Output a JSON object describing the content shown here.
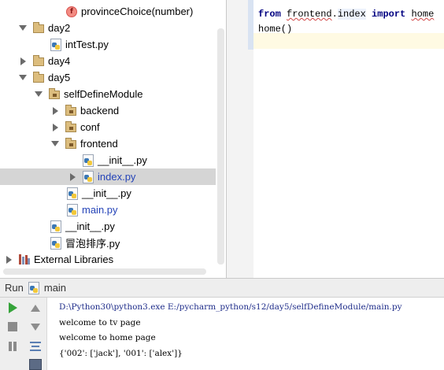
{
  "project_tree": {
    "items": [
      {
        "label": "provinceChoice(number)",
        "icon": "function-icon",
        "expand": "none",
        "color": "black"
      },
      {
        "label": "day2",
        "icon": "folder-icon",
        "expand": "down",
        "color": "black"
      },
      {
        "label": "intTest.py",
        "icon": "python-file-icon",
        "expand": "none",
        "color": "black"
      },
      {
        "label": "day4",
        "icon": "folder-icon",
        "expand": "right",
        "color": "black"
      },
      {
        "label": "day5",
        "icon": "folder-icon",
        "expand": "down",
        "color": "black"
      },
      {
        "label": "selfDefineModule",
        "icon": "package-icon",
        "expand": "down",
        "color": "black"
      },
      {
        "label": "backend",
        "icon": "package-icon",
        "expand": "right",
        "color": "black"
      },
      {
        "label": "conf",
        "icon": "package-icon",
        "expand": "right",
        "color": "black"
      },
      {
        "label": "frontend",
        "icon": "package-icon",
        "expand": "down",
        "color": "black"
      },
      {
        "label": "__init__.py",
        "icon": "python-file-icon",
        "expand": "none",
        "color": "black"
      },
      {
        "label": "index.py",
        "icon": "python-file-icon",
        "expand": "right",
        "color": "blue",
        "selected": true
      },
      {
        "label": "__init__.py",
        "icon": "python-file-icon",
        "expand": "none",
        "color": "black"
      },
      {
        "label": "main.py",
        "icon": "python-file-icon",
        "expand": "none",
        "color": "blue"
      },
      {
        "label": "__init__.py",
        "icon": "python-file-icon",
        "expand": "none",
        "color": "black"
      },
      {
        "label": "冒泡排序.py",
        "icon": "python-file-icon",
        "expand": "none",
        "color": "black"
      },
      {
        "label": "External Libraries",
        "icon": "library-icon",
        "expand": "right",
        "color": "black"
      }
    ]
  },
  "editor": {
    "line1": {
      "kw_from": "from",
      "module_a": "frontend",
      "dot": ".",
      "module_b": "index",
      "kw_import": "import",
      "name": "home"
    },
    "line2": "home()"
  },
  "run_window": {
    "title": "Run",
    "config_name": "main",
    "console": [
      "D:\\Python30\\python3.exe E:/pycharm_python/s12/day5/selfDefineModule/main.py",
      "welcome to tv page",
      "welcome to home page",
      "{'002': ['jack'], '001': ['alex']}"
    ]
  },
  "colors": {
    "selection": "#d5d5d5",
    "keyword": "#000080",
    "blue_file": "#2544b8",
    "run_green": "#35a33a"
  }
}
